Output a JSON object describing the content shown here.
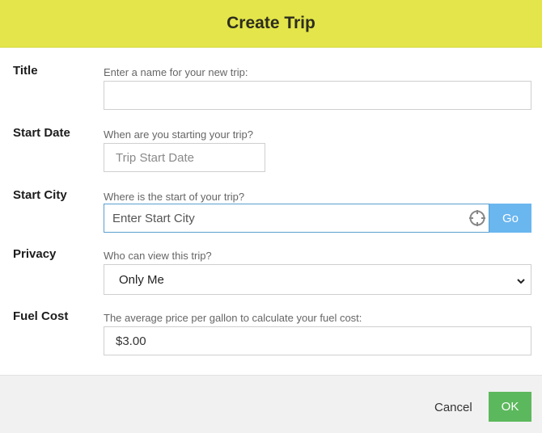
{
  "dialog": {
    "title": "Create Trip"
  },
  "fields": {
    "title": {
      "label": "Title",
      "help": "Enter a name for your new trip:",
      "value": "",
      "placeholder": ""
    },
    "start_date": {
      "label": "Start Date",
      "help": "When are you starting your trip?",
      "placeholder": "Trip Start Date"
    },
    "start_city": {
      "label": "Start City",
      "help": "Where is the start of your trip?",
      "placeholder": "Enter Start City",
      "go_label": "Go",
      "locate_icon": "crosshair-icon"
    },
    "privacy": {
      "label": "Privacy",
      "help": "Who can view this trip?",
      "selected": "Only Me"
    },
    "fuel_cost": {
      "label": "Fuel Cost",
      "help": "The average price per gallon to calculate your fuel cost:",
      "value": "$3.00"
    }
  },
  "footer": {
    "cancel_label": "Cancel",
    "ok_label": "OK"
  },
  "colors": {
    "header_bg": "#e3e54a",
    "go_button": "#6ab6ef",
    "ok_button": "#5cb85c",
    "focus_border": "#5a9fd0"
  }
}
